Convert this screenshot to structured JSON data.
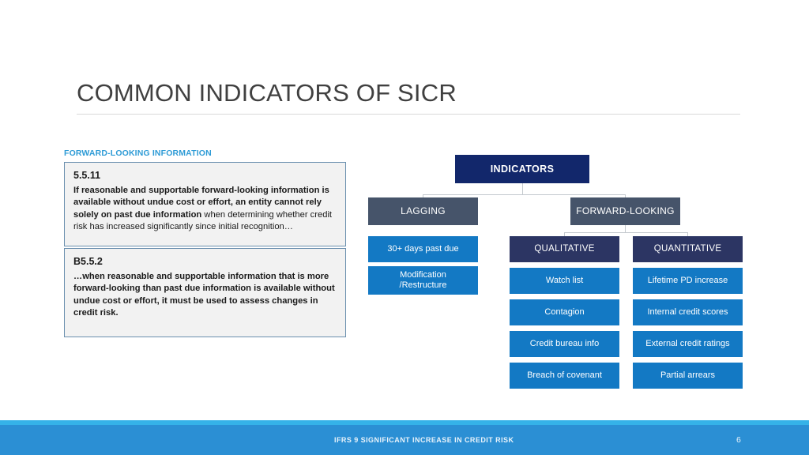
{
  "slide": {
    "title": "COMMON INDICATORS OF SICR",
    "section_label": "FORWARD-LOOKING INFORMATION"
  },
  "quotes": [
    {
      "ref": "5.5.11",
      "bold_part": "If reasonable and supportable forward-looking information is available without undue cost or effort, an entity cannot rely solely on past due information",
      "regular_part": " when determining whether credit risk has increased significantly since initial recognition…"
    },
    {
      "ref": "B5.5.2",
      "bold_part": "…when reasonable and supportable information that is more forward-looking than past due information is available without undue cost or effort, it must be used to assess changes in credit risk.",
      "regular_part": ""
    }
  ],
  "diagram": {
    "root": "INDICATORS",
    "branch_lagging": "LAGGING",
    "branch_forward": "FORWARD-LOOKING",
    "sub_qualitative": "QUALITATIVE",
    "sub_quantitative": "QUANTITATIVE",
    "lagging_items": [
      "30+ days past due",
      "Modification\n/Restructure"
    ],
    "qualitative_items": [
      "Watch list",
      "Contagion",
      "Credit bureau info",
      "Breach of covenant"
    ],
    "quantitative_items": [
      "Lifetime PD increase",
      "Internal credit scores",
      "External credit ratings",
      "Partial arrears"
    ],
    "colors": {
      "root": "#12276b",
      "level1": "#46546a",
      "level2": "#2c3563",
      "leaf": "#1379c4",
      "connector": "#c4c9ce"
    }
  },
  "footer": {
    "text": "IFRS 9 SIGNIFICANT INCREASE IN CREDIT RISK",
    "page_number": "6",
    "strip_color": "#35b2e8",
    "bar_color": "#2b8fd4"
  }
}
